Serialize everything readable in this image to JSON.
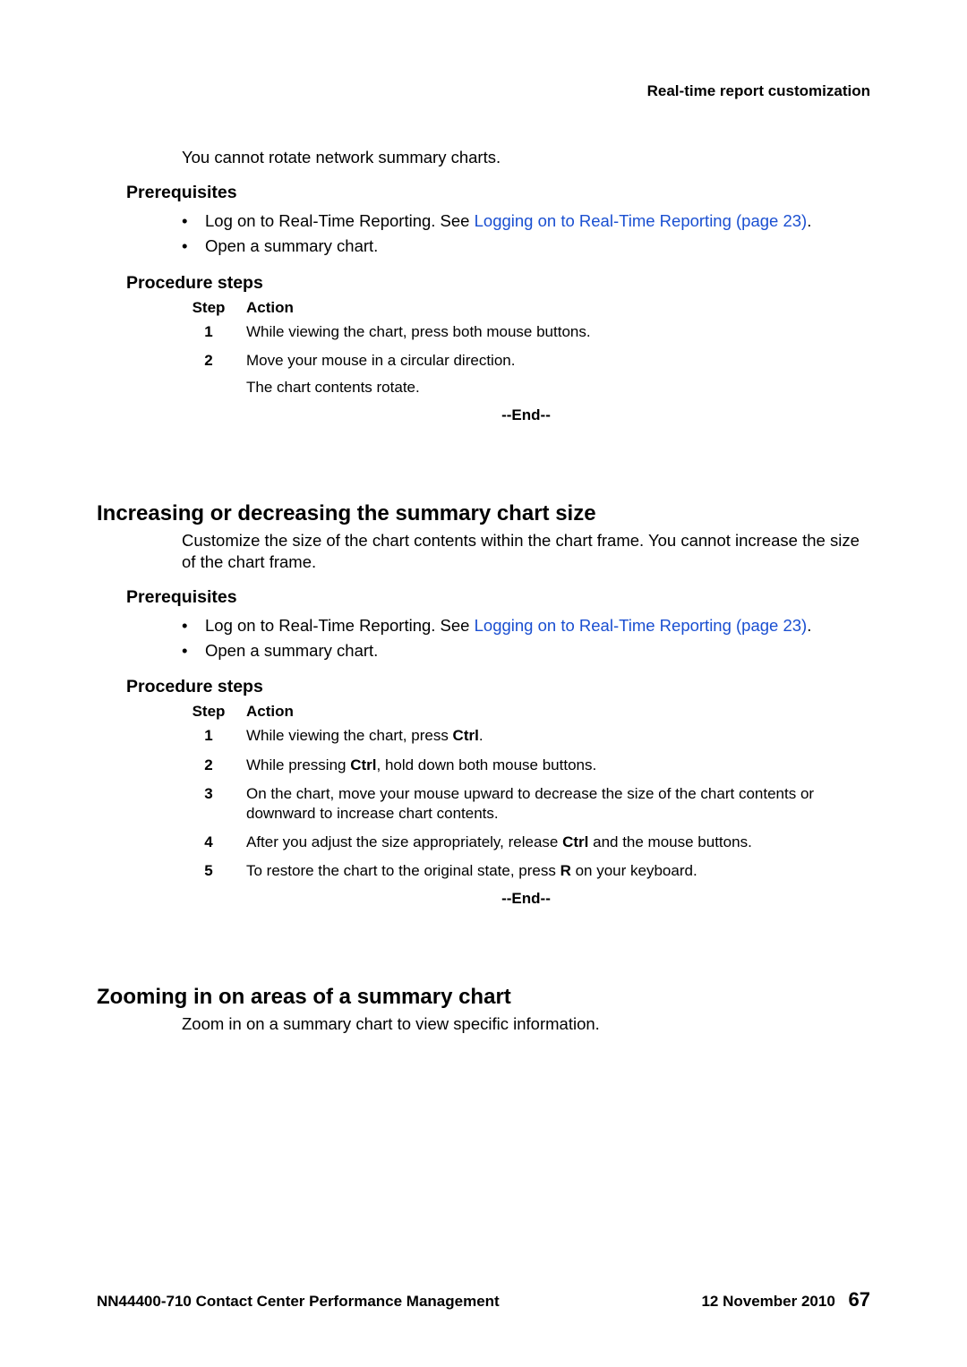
{
  "header": {
    "title": "Real-time report customization"
  },
  "section1": {
    "intro": "You cannot rotate network summary charts.",
    "prereq_heading": "Prerequisites",
    "prereq_items": {
      "item1_pre": "Log on to Real-Time Reporting. See ",
      "item1_link": "Logging on to Real-Time Reporting (page 23)",
      "item1_post": ".",
      "item2": "Open a summary chart."
    },
    "procsteps_heading": "Procedure steps",
    "proc_header": {
      "step": "Step",
      "action": "Action"
    },
    "steps": {
      "s1": {
        "num": "1",
        "text": "While viewing the chart, press both mouse buttons."
      },
      "s2": {
        "num": "2",
        "text": "Move your mouse in a circular direction.",
        "sub": "The chart contents rotate."
      }
    },
    "end": "--End--"
  },
  "section2": {
    "heading": "Increasing or decreasing the summary chart size",
    "body": "Customize the size of the chart contents within the chart frame. You cannot increase the size of the chart frame.",
    "prereq_heading": "Prerequisites",
    "prereq_items": {
      "item1_pre": "Log on to Real-Time Reporting. See ",
      "item1_link": "Logging on to Real-Time Reporting (page 23)",
      "item1_post": ".",
      "item2": "Open a summary chart."
    },
    "procsteps_heading": "Procedure steps",
    "proc_header": {
      "step": "Step",
      "action": "Action"
    },
    "steps": {
      "s1_num": "1",
      "s1_pre": "While viewing the chart, press ",
      "s1_bold": "Ctrl",
      "s1_post": ".",
      "s2_num": "2",
      "s2_pre": "While pressing ",
      "s2_bold": "Ctrl",
      "s2_post": ", hold down both mouse buttons.",
      "s3_num": "3",
      "s3_text": "On the chart, move your mouse upward to decrease the size of the chart contents or downward to increase chart contents.",
      "s4_num": "4",
      "s4_pre": "After you adjust the size appropriately, release ",
      "s4_bold": "Ctrl",
      "s4_post": " and the mouse buttons.",
      "s5_num": "5",
      "s5_pre": "To restore the chart to the original state, press ",
      "s5_bold": "R",
      "s5_post": " on your keyboard."
    },
    "end": "--End--"
  },
  "section3": {
    "heading": "Zooming in on areas of a summary chart",
    "body": "Zoom in on a summary chart to view specific information."
  },
  "footer": {
    "left": "NN44400-710 Contact Center Performance Management",
    "date": "12 November 2010",
    "page": "67"
  }
}
